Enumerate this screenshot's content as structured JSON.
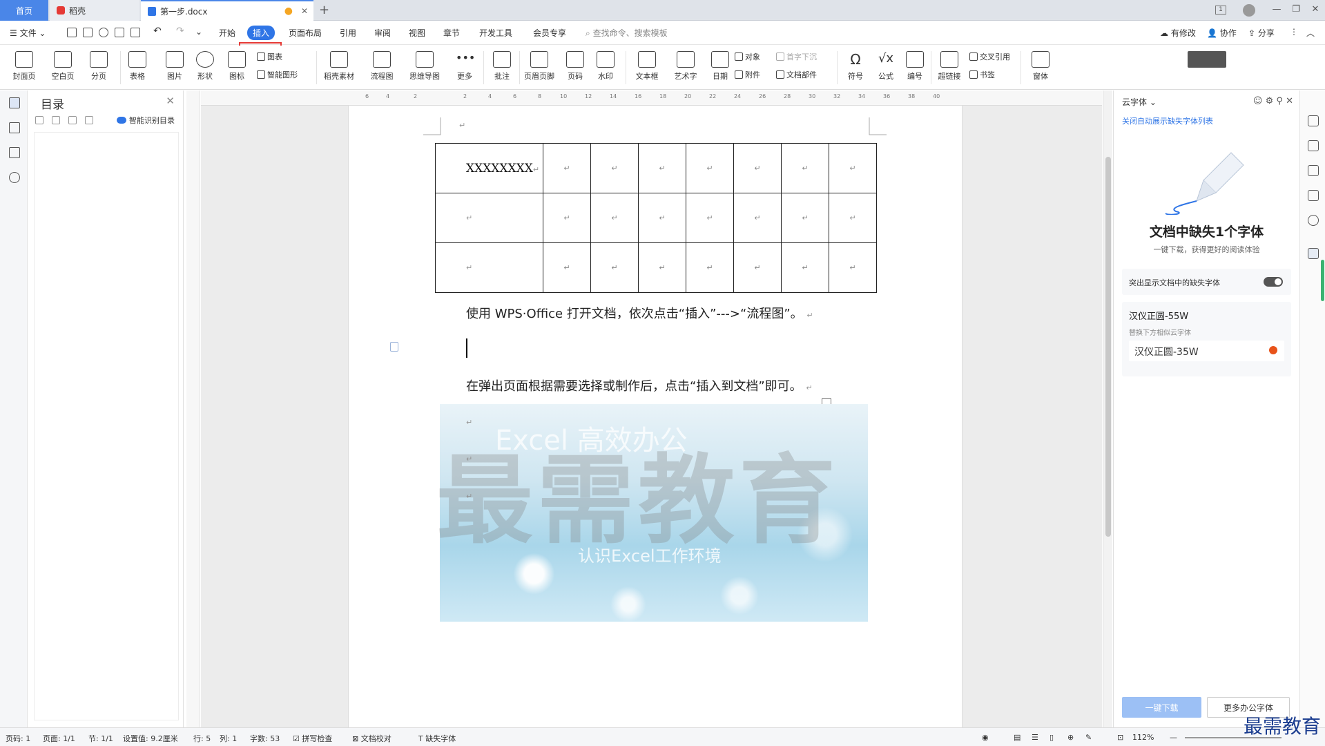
{
  "tabs": {
    "home": "首页",
    "daoke": "稻壳",
    "doc": "第一步.docx",
    "new_tab": "+"
  },
  "menu": {
    "file": "文件",
    "items": [
      "开始",
      "插入",
      "页面布局",
      "引用",
      "审阅",
      "视图",
      "章节",
      "开发工具",
      "会员专享"
    ],
    "search_placeholder": "查找命令、搜索模板",
    "right": [
      "有修改",
      "协作",
      "分享"
    ]
  },
  "ribbon": {
    "buttons": [
      "封面页",
      "空白页",
      "分页",
      "表格",
      "图片",
      "形状",
      "图标",
      "稻壳素材",
      "流程图",
      "思维导图",
      "更多",
      "批注",
      "页眉页脚",
      "页码",
      "水印",
      "文本框",
      "艺术字",
      "日期",
      "符号",
      "公式",
      "编号",
      "超链接",
      "窗体"
    ],
    "small": [
      "图表",
      "智能图形",
      "对象",
      "首字下沉",
      "附件",
      "文档部件",
      "交叉引用",
      "书签"
    ]
  },
  "toc": {
    "title": "目录",
    "smart": "智能识别目录"
  },
  "ruler": [
    "6",
    "4",
    "2",
    "2",
    "4",
    "6",
    "8",
    "10",
    "12",
    "14",
    "16",
    "18",
    "20",
    "22",
    "24",
    "26",
    "28",
    "30",
    "32",
    "34",
    "36",
    "38",
    "40"
  ],
  "document": {
    "cell_text": "XXXXXXXX",
    "para1": "使用 WPS·Office 打开文档，依次点击“插入”--->“流程图”。",
    "para2": "在弹出页面根据需要选择或制作后，点击“插入到文档”即可。",
    "pic_text1": "Excel  高效办公",
    "pic_text2": "认识Excel工作环境",
    "watermark": "最需教育"
  },
  "cloudfont": {
    "head": "云字体",
    "link": "关闭自动展示缺失字体列表",
    "title": "文档中缺失1个字体",
    "subtitle": "一键下载，获得更好的阅读体验",
    "toggle_label": "突出显示文档中的缺失字体",
    "missing_font": "汉仪正圆-55W",
    "replace_hint": "替换下方相似云字体",
    "replace_font": "汉仪正圆-35W",
    "download_btn": "一键下载",
    "more_btn": "更多办公字体"
  },
  "status": {
    "page": "页码: 1",
    "pages": "页面: 1/1",
    "section": "节: 1/1",
    "setting": "设置值: 9.2厘米",
    "row": "行: 5",
    "col": "列: 1",
    "words": "字数: 53",
    "spell": "拼写检查",
    "proof": "文档校对",
    "missing": "缺失字体",
    "zoom": "112%"
  },
  "corner_watermark": "最需教育",
  "colors": {
    "accent": "#2f75e6",
    "highlight": "#e53935"
  }
}
